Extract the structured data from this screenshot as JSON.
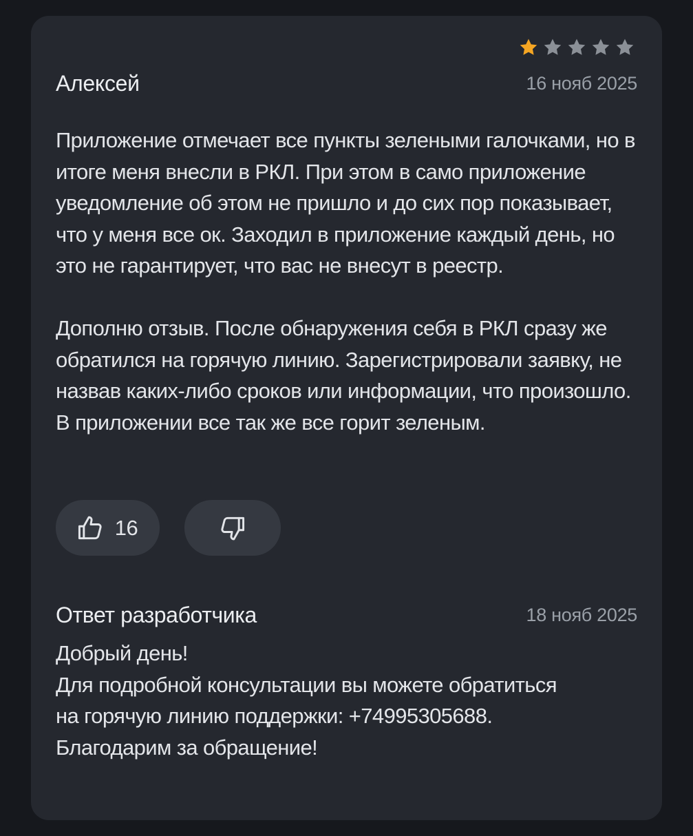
{
  "review": {
    "rating": 1,
    "max_rating": 5,
    "author": "Алексей",
    "date": "16 нояб 2025",
    "paragraphs": [
      "Приложение отмечает все пункты зелеными галочками, но в итоге меня внесли в РКЛ. При этом в само приложение уведомление об этом не пришло и до сих пор показывает, что у меня все ок. Заходил в приложение каждый день, но это не гарантирует, что вас не внесут в реестр.",
      "Дополню отзыв. После обнаружения себя в РКЛ сразу же обратился на горячую линию. Зарегистрировали заявку, не назвав каких-либо сроков или информации, что произошло. В приложении все так же все горит зеленым."
    ],
    "likes": "16"
  },
  "developer_reply": {
    "title": "Ответ разработчика",
    "date": "18 нояб 2025",
    "lines": [
      "Добрый день!",
      "Для подробной консультации вы можете обратиться",
      "на горячую линию поддержки: +74995305688.",
      "Благодарим за обращение!"
    ]
  },
  "colors": {
    "background": "#16181d",
    "card": "#25282f",
    "star_filled": "#f5a623",
    "star_empty": "#8b9097",
    "button": "#353941"
  },
  "icons": {
    "star": "star-icon",
    "like": "thumbs-up-icon",
    "dislike": "thumbs-down-icon"
  }
}
